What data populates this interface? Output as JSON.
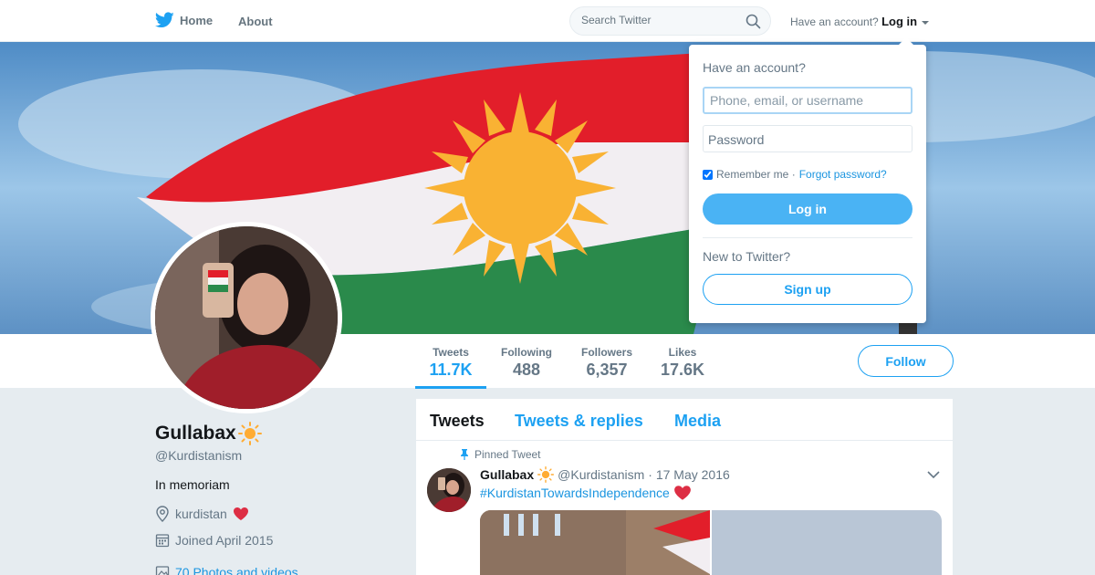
{
  "nav": {
    "home_label": "Home",
    "about_label": "About",
    "search_placeholder": "Search Twitter",
    "have_account_label": "Have an account?",
    "login_label": "Log in"
  },
  "stats": [
    {
      "label": "Tweets",
      "value": "11.7K"
    },
    {
      "label": "Following",
      "value": "488"
    },
    {
      "label": "Followers",
      "value": "6,357"
    },
    {
      "label": "Likes",
      "value": "17.6K"
    }
  ],
  "follow_label": "Follow",
  "profile": {
    "name": "Gullabax",
    "handle": "@Kurdistanism",
    "bio": "In memoriam",
    "location": "kurdistan",
    "joined": "Joined April 2015",
    "photos": "70 Photos and videos"
  },
  "tabs": [
    "Tweets",
    "Tweets & replies",
    "Media"
  ],
  "tweet": {
    "pinned_label": "Pinned Tweet",
    "author": "Gullabax",
    "handle": "@Kurdistanism",
    "date": "· 17 May 2016",
    "text": "#KurdistanTowardsIndependence"
  },
  "login_dropdown": {
    "title": "Have an account?",
    "username_placeholder": "Phone, email, or username",
    "password_label": "Password",
    "remember_label": "Remember me ·",
    "forgot_label": "Forgot password?",
    "login_button": "Log in",
    "new_label": "New to Twitter?",
    "signup_button": "Sign up"
  },
  "colors": {
    "accent": "#1da1f2",
    "flag_red": "#e21e2a",
    "flag_green": "#2a8a4b",
    "flag_sun": "#f9b233"
  }
}
